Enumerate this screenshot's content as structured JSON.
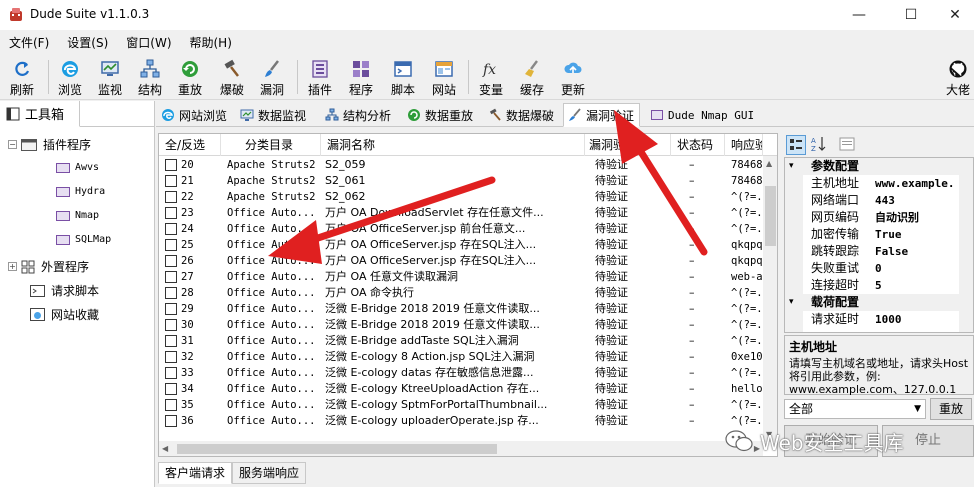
{
  "window": {
    "title": "Dude Suite v1.1.0.3",
    "controls": {
      "minimize": "—",
      "maximize": "☐",
      "close": "✕"
    }
  },
  "menu": [
    "文件(F)",
    "设置(S)",
    "窗口(W)",
    "帮助(H)"
  ],
  "toolbar": {
    "left": [
      {
        "label": "刷新",
        "icon": "refresh-icon"
      },
      {
        "label": "浏览",
        "icon": "edge-browser-icon"
      },
      {
        "label": "监视",
        "icon": "monitor-icon"
      },
      {
        "label": "结构",
        "icon": "structure-icon"
      },
      {
        "label": "重放",
        "icon": "replay-icon"
      },
      {
        "label": "爆破",
        "icon": "hammer-icon"
      },
      {
        "label": "漏洞",
        "icon": "brush-icon"
      },
      {
        "label": "插件",
        "icon": "plugin-icon"
      },
      {
        "label": "程序",
        "icon": "program-icon"
      },
      {
        "label": "脚本",
        "icon": "script-icon"
      },
      {
        "label": "网站",
        "icon": "website-icon"
      },
      {
        "label": "变量",
        "icon": "variable-icon"
      },
      {
        "label": "缓存",
        "icon": "cache-icon"
      },
      {
        "label": "更新",
        "icon": "update-icon"
      }
    ],
    "right": {
      "label": "大佬",
      "icon": "github-icon"
    }
  },
  "left_panel": {
    "tab": "工具箱",
    "tree": [
      {
        "label": "插件程序",
        "expander": "−"
      },
      {
        "label": "Awvs"
      },
      {
        "label": "Hydra"
      },
      {
        "label": "Nmap"
      },
      {
        "label": "SQLMap"
      },
      {
        "label": "外置程序",
        "expander": "+"
      },
      {
        "label": "请求脚本"
      },
      {
        "label": "网站收藏"
      }
    ]
  },
  "tabs": [
    "网站浏览",
    "数据监视",
    "结构分析",
    "数据重放",
    "数据爆破",
    "漏洞验证",
    "Dude Nmap GUI"
  ],
  "active_tab": "漏洞验证",
  "table": {
    "headers": [
      "全/反选",
      "分类目录",
      "漏洞名称",
      "漏洞验证",
      "状态码",
      "响应验"
    ],
    "rows": [
      {
        "id": "20",
        "cat": "Apache Struts2",
        "name": "S2_059",
        "verify": "待验证",
        "status": "–",
        "resp": "78468"
      },
      {
        "id": "21",
        "cat": "Apache Struts2",
        "name": "S2_061",
        "verify": "待验证",
        "status": "–",
        "resp": "78468"
      },
      {
        "id": "22",
        "cat": "Apache Struts2",
        "name": "S2_062",
        "verify": "待验证",
        "status": "–",
        "resp": "^(?=."
      },
      {
        "id": "23",
        "cat": "Office Auto...",
        "name": "万户 OA DownloadServlet 存在任意文件...",
        "verify": "待验证",
        "status": "–",
        "resp": "^(?=."
      },
      {
        "id": "24",
        "cat": "Office Auto...",
        "name": "万户 OA OfficeServer.jsp 前台任意文...",
        "verify": "待验证",
        "status": "–",
        "resp": "^(?=."
      },
      {
        "id": "25",
        "cat": "Office Auto...",
        "name": "万户 OA OfficeServer.jsp 存在SQL注入...",
        "verify": "待验证",
        "status": "–",
        "resp": "qkqpq"
      },
      {
        "id": "26",
        "cat": "Office Auto...",
        "name": "万户 OA OfficeServer.jsp 存在SQL注入...",
        "verify": "待验证",
        "status": "–",
        "resp": "qkqpq"
      },
      {
        "id": "27",
        "cat": "Office Auto...",
        "name": "万户 OA 任意文件读取漏洞",
        "verify": "待验证",
        "status": "–",
        "resp": "web-a"
      },
      {
        "id": "28",
        "cat": "Office Auto...",
        "name": "万户 OA 命令执行",
        "verify": "待验证",
        "status": "–",
        "resp": "^(?=."
      },
      {
        "id": "29",
        "cat": "Office Auto...",
        "name": "泛微 E-Bridge 2018 2019 任意文件读取...",
        "verify": "待验证",
        "status": "–",
        "resp": "^(?=."
      },
      {
        "id": "30",
        "cat": "Office Auto...",
        "name": "泛微 E-Bridge 2018 2019 任意文件读取...",
        "verify": "待验证",
        "status": "–",
        "resp": "^(?=."
      },
      {
        "id": "31",
        "cat": "Office Auto...",
        "name": "泛微 E-Bridge addTaste SQL注入漏洞",
        "verify": "待验证",
        "status": "–",
        "resp": "^(?=."
      },
      {
        "id": "32",
        "cat": "Office Auto...",
        "name": "泛微 E-cology 8 Action.jsp SQL注入漏洞",
        "verify": "待验证",
        "status": "–",
        "resp": "0xe10"
      },
      {
        "id": "33",
        "cat": "Office Auto...",
        "name": "泛微 E-cology datas 存在敏感信息泄露...",
        "verify": "待验证",
        "status": "–",
        "resp": "^(?=."
      },
      {
        "id": "34",
        "cat": "Office Auto...",
        "name": "泛微 E-cology KtreeUploadAction 存在...",
        "verify": "待验证",
        "status": "–",
        "resp": "hello"
      },
      {
        "id": "35",
        "cat": "Office Auto...",
        "name": "泛微 E-cology SptmForPortalThumbnail...",
        "verify": "待验证",
        "status": "–",
        "resp": "^(?=."
      },
      {
        "id": "36",
        "cat": "Office Auto...",
        "name": "泛微 E-cology uploaderOperate.jsp 存...",
        "verify": "待验证",
        "status": "–",
        "resp": "^(?=."
      }
    ]
  },
  "bottom_tabs": [
    "客户端请求",
    "服务端响应"
  ],
  "properties": {
    "sections": [
      {
        "title": "参数配置",
        "rows": [
          {
            "key": "主机地址",
            "value": "www.example."
          },
          {
            "key": "网络端口",
            "value": "443"
          },
          {
            "key": "网页编码",
            "value": "自动识别"
          },
          {
            "key": "加密传输",
            "value": "True"
          },
          {
            "key": "跳转跟踪",
            "value": "False"
          },
          {
            "key": "失败重试",
            "value": "0"
          },
          {
            "key": "连接超时",
            "value": "5"
          }
        ]
      },
      {
        "title": "载荷配置",
        "rows": [
          {
            "key": "请求延时",
            "value": "1000"
          }
        ]
      }
    ],
    "desc_title": "主机地址",
    "desc_text": "请填写主机域名或地址，请求头Host将引用此参数，例: www.example.com、127.0.0.1"
  },
  "filter_select": "全部",
  "redo_button": "重放",
  "start_button": "开始验证",
  "stop_button": "停止",
  "watermark": "Web安全工具库",
  "colors": {
    "accent": "#0078d7",
    "arrow": "#e02020",
    "icon_purple": "#7a4fa5"
  }
}
